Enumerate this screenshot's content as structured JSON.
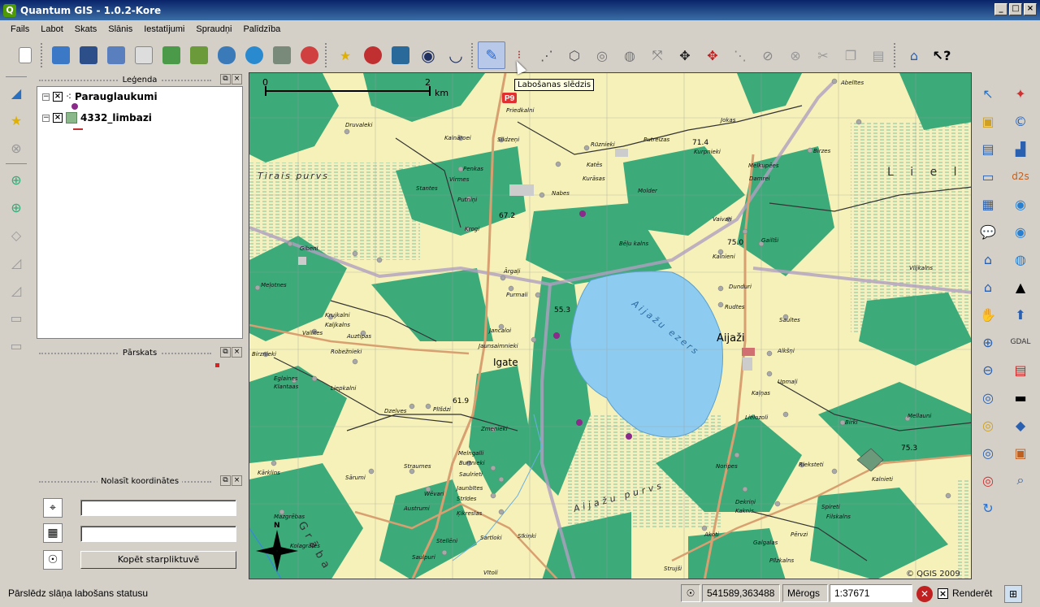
{
  "window": {
    "title": "Quantum GIS - 1.0.2-Kore",
    "controls": [
      "_",
      "□",
      "×"
    ]
  },
  "menu": [
    "Fails",
    "Labot",
    "Skats",
    "Slānis",
    "Iestatījumi",
    "Spraudņi",
    "Palīdzība"
  ],
  "tooltip": "Labošanas slēdzis",
  "legend": {
    "title": "Leģenda",
    "layers": [
      {
        "name": "Parauglaukumi",
        "checked": "×",
        "icon": "point-layer-icon"
      },
      {
        "name": "4332_limbazi",
        "checked": "×",
        "icon": "raster-layer-icon"
      }
    ]
  },
  "overview": {
    "title": "Pārskats"
  },
  "coords": {
    "title": "Nolasīt koordinātes",
    "copy_button": "Kopēt starpliktuvē"
  },
  "map": {
    "scalebar": {
      "left": "0",
      "right": "2",
      "unit": "km"
    },
    "copyright": "© QGIS 2009",
    "badge": "P9",
    "elevations": [
      "71.4",
      "67.2",
      "75.0",
      "55.3",
      "61.9",
      "75.3"
    ],
    "labels": {
      "lake": "Aijažu ezers",
      "bog1": "Tirais purvs",
      "bog2": "Aijažu purvs",
      "river": "Grāba",
      "town1": "Aijaži",
      "town2": "Igate",
      "north": "N",
      "lie": "L i e l",
      "places": [
        "Abelītes",
        "Priedkalni",
        "Jokas",
        "Druvaleki",
        "Kalnāroei",
        "Sildzeņi",
        "Putreizas",
        "Rūznieki",
        "Kurpnieki",
        "Birzes",
        "Penkas",
        "Virmes",
        "Katēs",
        "Kurāsas",
        "Nabes",
        "Molder",
        "Stantes",
        "Putniņi",
        "Melkupēes",
        "Damrei",
        "Vaivari",
        "Gailīši",
        "Kalnieni",
        "Krogi",
        "Gibeni",
        "Bēļu kalns",
        "Viljkalns",
        "Dunduri",
        "Ārgaļi",
        "Meļotnes",
        "Purmali",
        "Rudtes",
        "Saultes",
        "Krujkalni",
        "Kaljkalns",
        "Vallites",
        "Auztipas",
        "Jancaloi",
        "Jaunsaimnieki",
        "Alkšņi",
        "Birznieki",
        "Robežnieki",
        "Upmaļi",
        "Liepkalni",
        "Kaļņas",
        "Eglaines",
        "Klantaas",
        "Dzelves",
        "Plīšdzi",
        "Lielozoli",
        "Mellauni",
        "Birki",
        "Zmenieki",
        "Melngalli",
        "Burtnieki",
        "Saulrieti",
        "Jaunbītes",
        "Strīdes",
        "Ķikreslas",
        "Kārklins",
        "Sārumi",
        "Straumes",
        "Wēvari",
        "Austrumi",
        "Noripes",
        "Rieksteti",
        "Kalnieti",
        "Mazgrēbas",
        "Sartloki",
        "Sīkiņki",
        "Stellēni",
        "Dekriņi",
        "Kaknis",
        "Spireti",
        "Filskalns",
        "Kolagrāfes",
        "Saulpuri",
        "Vītoli",
        "Akoti",
        "Galgalas",
        "Pērvzi",
        "Strujši",
        "Pīlzkalns"
      ]
    }
  },
  "statusbar": {
    "message": "Pārslēdz slāņa labošans statusu",
    "coordinates": "541589,363488",
    "scale_label": "Mērogs",
    "scale_value": "1:37671",
    "render_label": "Renderēt",
    "render_checked": "×"
  }
}
